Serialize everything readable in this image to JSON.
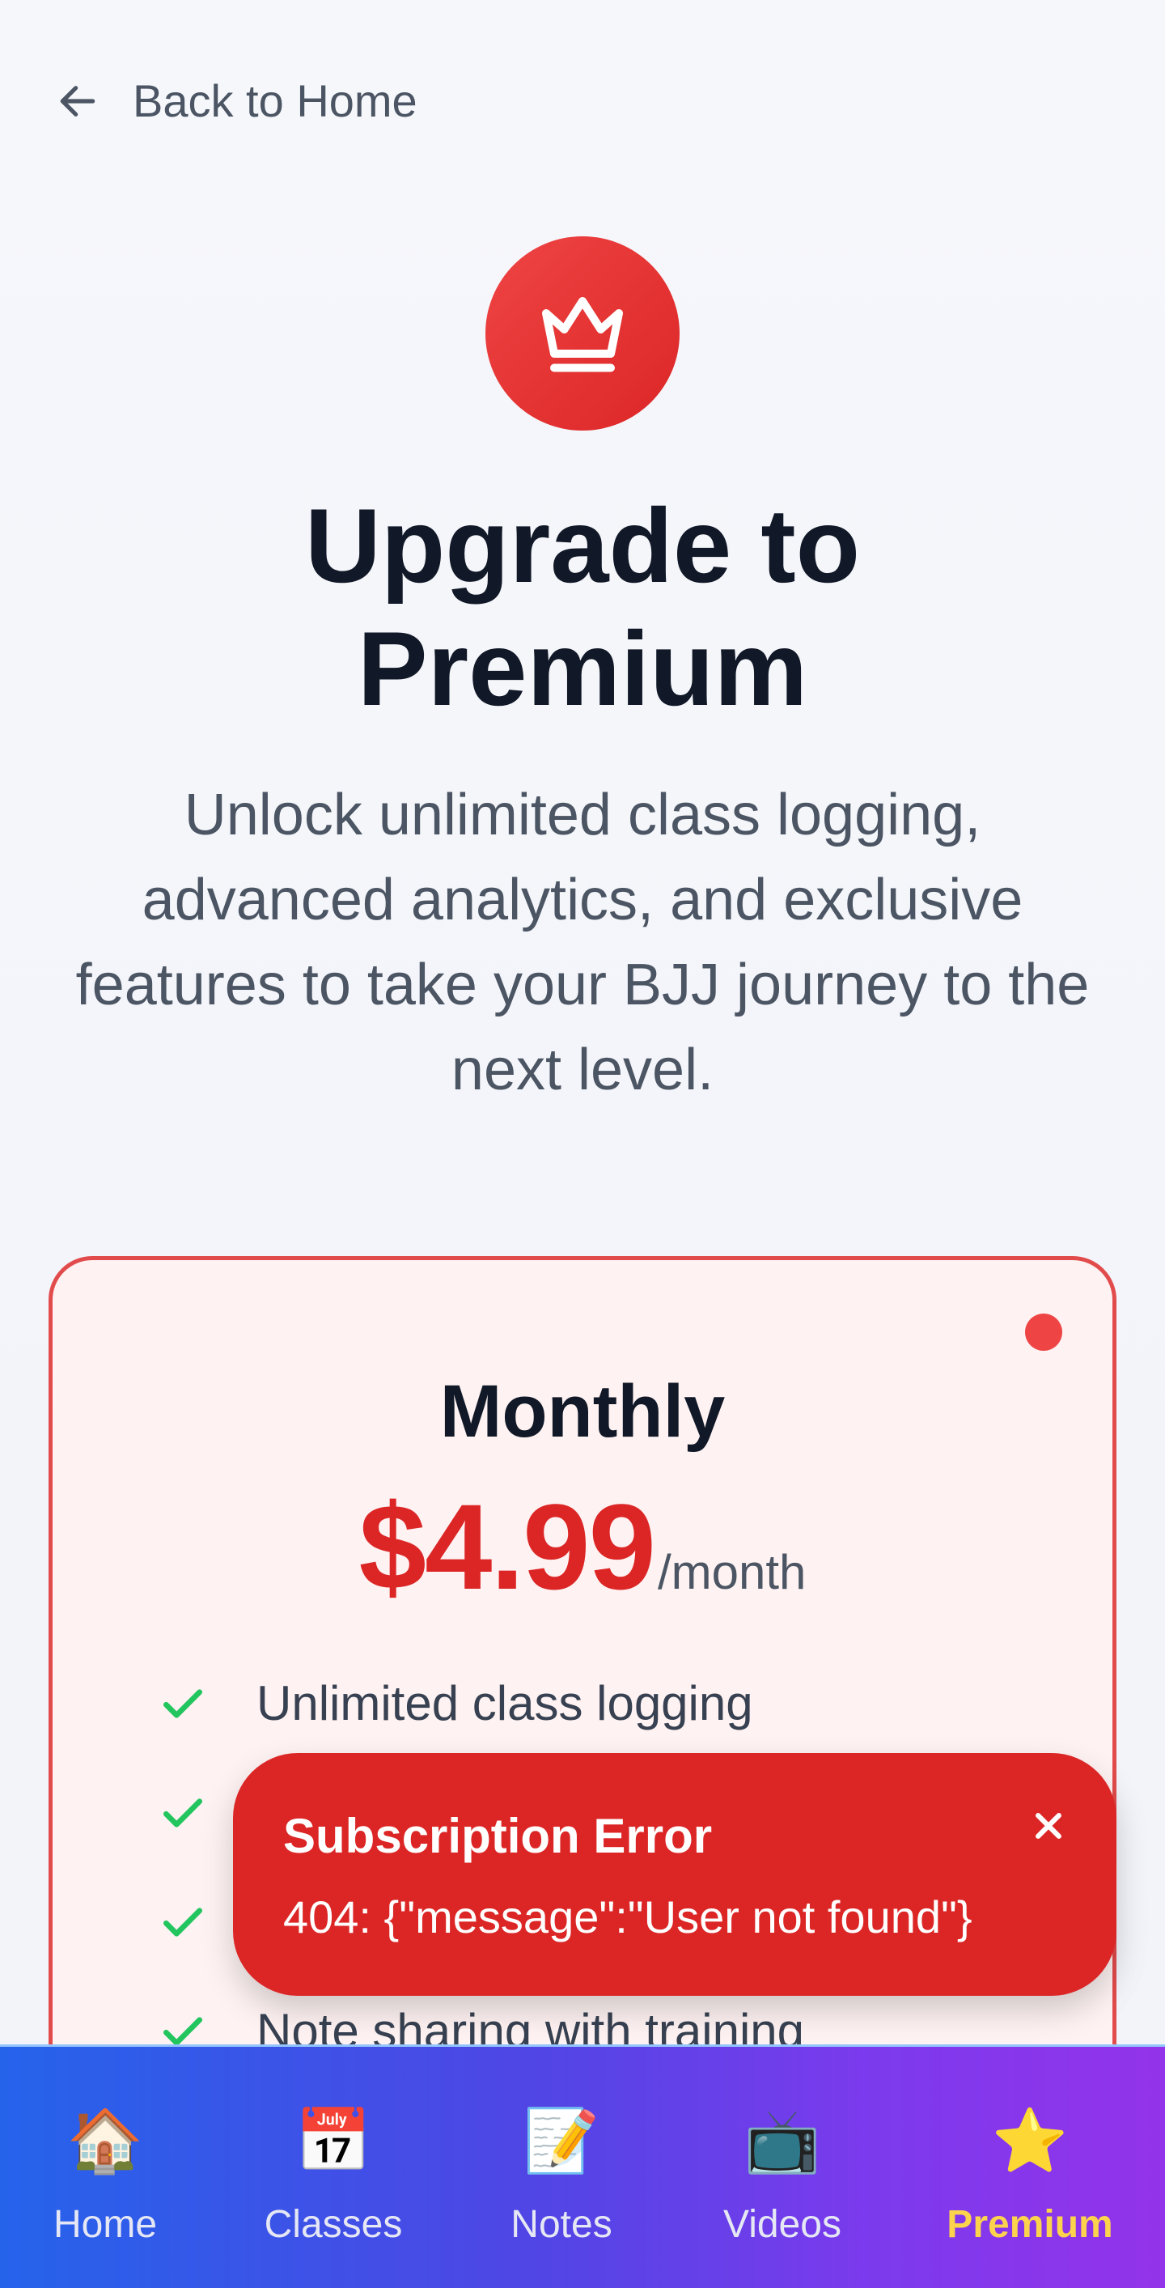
{
  "back": {
    "label": "Back to Home"
  },
  "hero": {
    "title_line1": "Upgrade to",
    "title_line2": "Premium",
    "subtitle": "Unlock unlimited class logging, advanced analytics, and exclusive features to take your BJJ journey to the next level."
  },
  "plan": {
    "name": "Monthly",
    "price": "$4.99",
    "period": "/month",
    "selected": true,
    "features": [
      "Unlimited class logging",
      "",
      "",
      "Note sharing with training"
    ]
  },
  "toast": {
    "title": "Subscription Error",
    "message": "404: {\"message\":\"User not found\"}"
  },
  "nav": {
    "items": [
      {
        "icon": "🏠",
        "icon_name": "home-icon",
        "label": "Home",
        "active": false
      },
      {
        "icon": "📅",
        "icon_name": "calendar-icon",
        "label": "Classes",
        "active": false
      },
      {
        "icon": "📝",
        "icon_name": "memo-icon",
        "label": "Notes",
        "active": false
      },
      {
        "icon": "📺",
        "icon_name": "tv-icon",
        "label": "Videos",
        "active": false
      },
      {
        "icon": "⭐",
        "icon_name": "star-icon",
        "label": "Premium",
        "active": true
      }
    ]
  },
  "colors": {
    "accent_red": "#dc2626",
    "check_green": "#22c55e",
    "nav_gradient_start": "#2563eb",
    "nav_gradient_end": "#9333ea",
    "active_nav": "#fcd34d"
  }
}
